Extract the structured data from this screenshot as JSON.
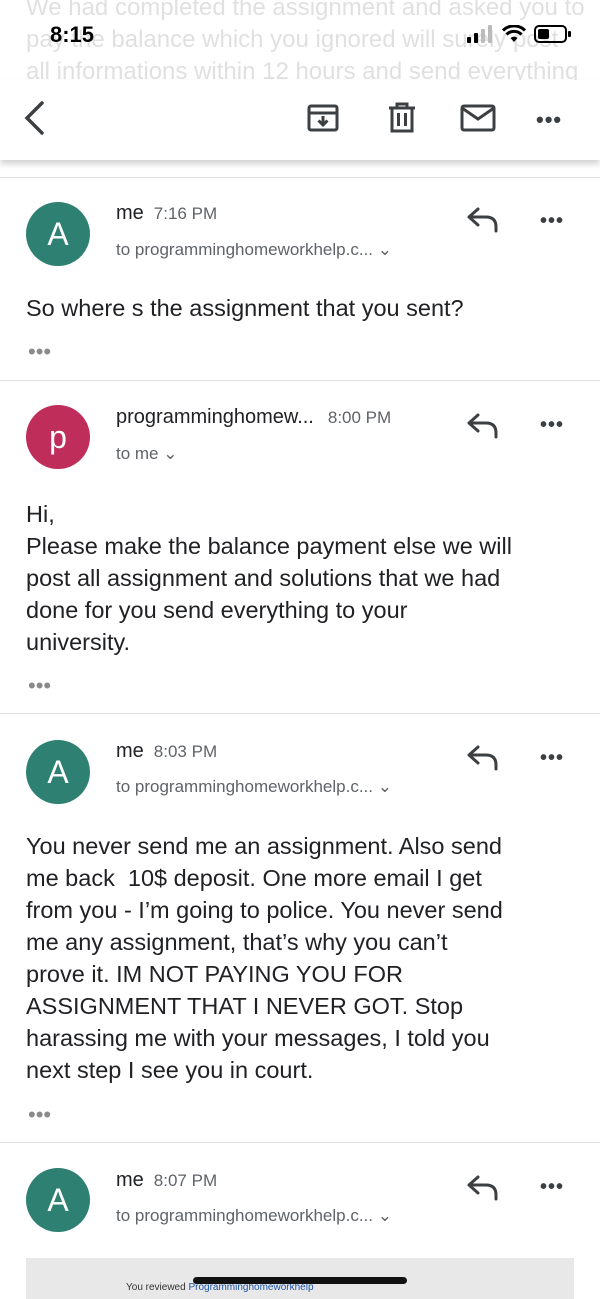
{
  "status": {
    "time": "8:15",
    "background_text": "We had completed the assignment and asked you to pay the balance which you ignored will surely post all informations within 12 hours and send everything to your university."
  },
  "toolbar": {
    "back_icon": "back-arrow-icon",
    "archive_icon": "archive-icon",
    "delete_icon": "trash-icon",
    "mail_icon": "mail-icon",
    "more_label": "•••"
  },
  "messages": [
    {
      "avatar": "A",
      "avatar_color": "#2e8072",
      "sender": "me",
      "time": "7:16 PM",
      "recipient": "to programminghomeworkhelp.c... ⌄",
      "body": "So where s the assignment that you sent?",
      "more": "•••",
      "dots": "•••"
    },
    {
      "avatar": "p",
      "avatar_color": "#bf2d5a",
      "sender": "programminghomew...",
      "time": "8:00 PM",
      "recipient": "to me ⌄",
      "body": "Hi,\nPlease make the balance payment else we will\npost all assignment and solutions that we had\ndone for you send everything to your\nuniversity.",
      "more": "•••",
      "dots": "•••"
    },
    {
      "avatar": "A",
      "avatar_color": "#2e8072",
      "sender": "me",
      "time": "8:03 PM",
      "recipient": "to programminghomeworkhelp.c... ⌄",
      "body": "You never send me an assignment. Also send\nme back  10$ deposit. One more email I get\nfrom you - I’m going to police. You never send\nme any assignment, that’s why you can’t\nprove it. IM NOT PAYING YOU FOR\nASSIGNMENT THAT I NEVER GOT. Stop\nharassing me with your messages, I told you\nnext step I see you in court.",
      "more": "•••",
      "dots": "•••"
    },
    {
      "avatar": "A",
      "avatar_color": "#2e8072",
      "sender": "me",
      "time": "8:07 PM",
      "recipient": "to programminghomeworkhelp.c... ⌄",
      "more": "•••"
    }
  ],
  "attachment": {
    "prefix": "You reviewed ",
    "link": "Programminghomeworkhelp"
  }
}
